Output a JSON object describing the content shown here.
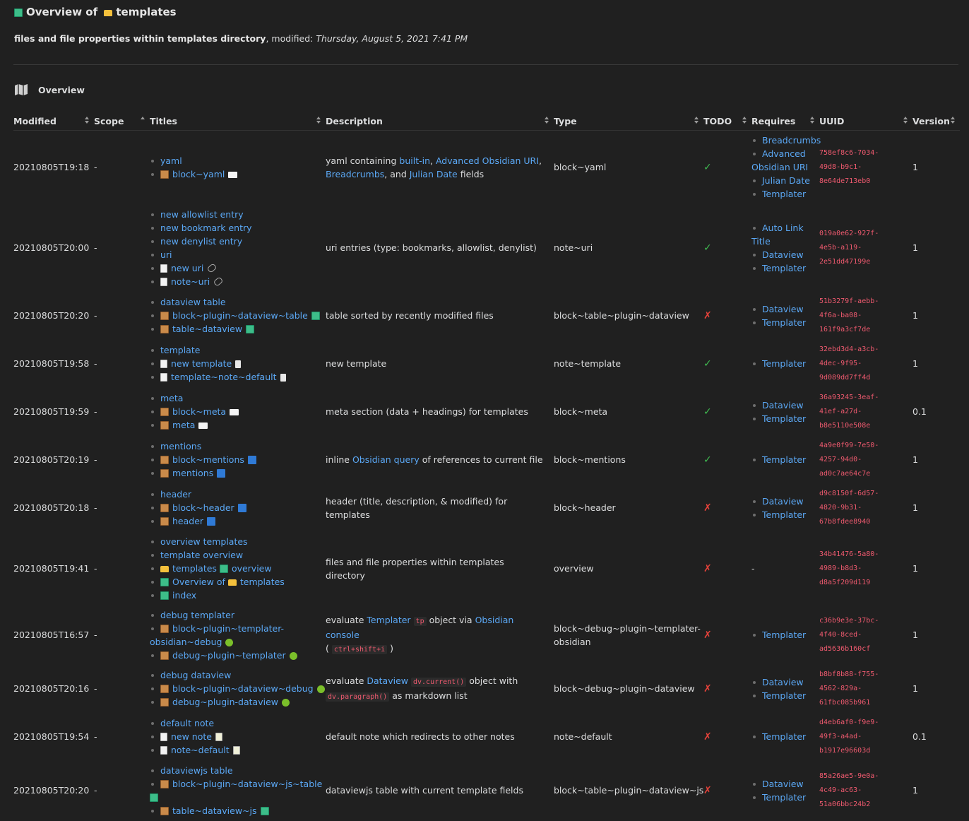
{
  "header": {
    "title_prefix": "Overview of",
    "title_folder": "templates",
    "desc_bold": "files and file properties within templates directory",
    "modified_label": ", modified:",
    "modified_value": "Thursday, August 5, 2021 7:41 PM",
    "section_title": "Overview"
  },
  "columns": [
    "Modified",
    "Scope",
    "Titles",
    "Description",
    "Type",
    "TODO",
    "Requires",
    "UUID",
    "Version"
  ],
  "rows": [
    {
      "modified": "20210805T19:18",
      "scope": "-",
      "titles": [
        "yaml",
        "block~yaml"
      ],
      "type": "block~yaml",
      "todo": "✓",
      "requires": [
        "Breadcrumbs",
        "Advanced",
        "Obsidian URI",
        "Julian Date",
        "Templater"
      ],
      "uuid": [
        "758ef8c6-7034-",
        "49d8-b9c1-",
        "8e64de713eb0"
      ],
      "version": "1"
    },
    {
      "modified": "20210805T20:00",
      "scope": "-",
      "titles": [
        "new allowlist entry",
        "new bookmark entry",
        "new denylist entry",
        "uri",
        "new uri",
        "note~uri"
      ],
      "description": "uri entries (type: bookmarks, allowlist, denylist)",
      "type": "note~uri",
      "todo": "✓",
      "requires": [
        "Auto Link",
        "Title",
        "Dataview",
        "Templater"
      ],
      "uuid": [
        "019a0e62-927f-",
        "4e5b-a119-",
        "2e51dd47199e"
      ],
      "version": "1"
    },
    {
      "modified": "20210805T20:20",
      "scope": "-",
      "titles": [
        "dataview table",
        "block~plugin~dataview~table",
        "table~dataview"
      ],
      "description": "table sorted by recently modified files",
      "type": "block~table~plugin~dataview",
      "todo": "✗",
      "requires": [
        "Dataview",
        "Templater"
      ],
      "uuid": [
        "51b3279f-aebb-",
        "4f6a-ba08-",
        "161f9a3cf7de"
      ],
      "version": "1"
    },
    {
      "modified": "20210805T19:58",
      "scope": "-",
      "titles": [
        "template",
        "new template",
        "template~note~default"
      ],
      "description": "new template",
      "type": "note~template",
      "todo": "✓",
      "requires": [
        "Templater"
      ],
      "uuid": [
        "32ebd3d4-a3cb-",
        "4dec-9f95-",
        "9d089dd7ff4d"
      ],
      "version": "1"
    },
    {
      "modified": "20210805T19:59",
      "scope": "-",
      "titles": [
        "meta",
        "block~meta",
        "meta"
      ],
      "description": "meta section (data + headings) for templates",
      "type": "block~meta",
      "todo": "✓",
      "requires": [
        "Dataview",
        "Templater"
      ],
      "uuid": [
        "36a93245-3eaf-",
        "41ef-a27d-",
        "b8e5110e508e"
      ],
      "version": "0.1"
    },
    {
      "modified": "20210805T20:19",
      "scope": "-",
      "titles": [
        "mentions",
        "block~mentions",
        "mentions"
      ],
      "type": "block~mentions",
      "todo": "✓",
      "requires": [
        "Templater"
      ],
      "uuid": [
        "4a9e0f99-7e50-",
        "4257-94d0-",
        "ad0c7ae64c7e"
      ],
      "version": "1"
    },
    {
      "modified": "20210805T20:18",
      "scope": "-",
      "titles": [
        "header",
        "block~header",
        "header"
      ],
      "description": "header (title, description, & modified) for templates",
      "type": "block~header",
      "todo": "✗",
      "requires": [
        "Dataview",
        "Templater"
      ],
      "uuid": [
        "d9c8150f-6d57-",
        "4820-9b31-",
        "67b8fdee8940"
      ],
      "version": "1"
    },
    {
      "modified": "20210805T19:41",
      "scope": "-",
      "titles": [
        "overview templates",
        "template overview",
        "templates",
        "overview",
        "Overview of",
        "templates",
        "index"
      ],
      "description": "files and file properties within templates directory",
      "type": "overview",
      "todo": "✗",
      "requires_text": "-",
      "uuid": [
        "34b41476-5a80-",
        "4989-b8d3-",
        "d8a5f209d119"
      ],
      "version": "1"
    },
    {
      "modified": "20210805T16:57",
      "scope": "-",
      "titles": [
        "debug templater",
        "block~plugin~templater-",
        "obsidian~debug",
        "debug~plugin~templater"
      ],
      "type": "block~debug~plugin~templater-obsidian",
      "todo": "✗",
      "requires": [
        "Templater"
      ],
      "uuid": [
        "c36b9e3e-37bc-",
        "4f40-8ced-",
        "ad5636b160cf"
      ],
      "version": "1"
    },
    {
      "modified": "20210805T20:16",
      "scope": "-",
      "titles": [
        "debug dataview",
        "block~plugin~dataview~debug",
        "debug~plugin-dataview"
      ],
      "type": "block~debug~plugin~dataview",
      "todo": "✗",
      "requires": [
        "Dataview",
        "Templater"
      ],
      "uuid": [
        "b8bf8b88-f755-",
        "4562-829a-",
        "61fbc085b961"
      ],
      "version": "1"
    },
    {
      "modified": "20210805T19:54",
      "scope": "-",
      "titles": [
        "default note",
        "new note",
        "note~default"
      ],
      "description": "default note which redirects to other notes",
      "type": "note~default",
      "todo": "✗",
      "requires": [
        "Templater"
      ],
      "uuid": [
        "d4eb6af0-f9e9-",
        "49f3-a4ad-",
        "b1917e96603d"
      ],
      "version": "0.1"
    },
    {
      "modified": "20210805T20:20",
      "scope": "-",
      "titles": [
        "dataviewjs table",
        "block~plugin~dataview~js~table",
        "table~dataview~js"
      ],
      "description": "dataviewjs table with current template fields",
      "type": "block~table~plugin~dataview~js",
      "todo": "✗",
      "requires": [
        "Dataview",
        "Templater"
      ],
      "uuid": [
        "85a26ae5-9e0a-",
        "4c49-ac63-",
        "51a06bbc24b2"
      ],
      "version": "1"
    }
  ],
  "rich_desc": {
    "yaml": {
      "t1": "yaml containing ",
      "l1": "built-in",
      "t2": ", ",
      "l2": "Advanced Obsidian URI",
      "t3": ",",
      "l3": "Breadcrumbs",
      "t4": ", and ",
      "l4": "Julian Date",
      "t5": " fields"
    },
    "mentions": {
      "t1": "inline ",
      "l1": "Obsidian query",
      "t2": " of references to current file"
    },
    "debug_templater": {
      "t1": "evaluate ",
      "l1": "Templater",
      "c1": "tp",
      "t2": " object via ",
      "l2": "Obsidian console",
      "t3": "( ",
      "c2": "ctrl+shift+i",
      "t4": " )"
    },
    "debug_dataview": {
      "t1": "evaluate ",
      "l1": "Dataview",
      "c1": "dv.current()",
      "t2": " object with",
      "c2": "dv.paragraph()",
      "t3": " as markdown list"
    }
  },
  "icons": {
    "title": "book-icon",
    "folder": "folder-icon",
    "section": "map-icon",
    "block": "package-icon",
    "note": "page-icon"
  },
  "colors": {
    "background": "#202020",
    "text": "#dcddde",
    "link": "#5ba8f5",
    "code": "#ef5a6f",
    "check": "#3fb950",
    "cross": "#e5423a"
  }
}
